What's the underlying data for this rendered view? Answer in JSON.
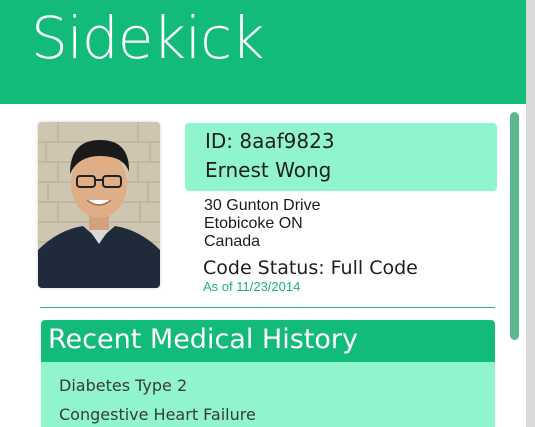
{
  "app": {
    "title": "Sidekick"
  },
  "patient": {
    "id_line": "ID: 8aaf9823",
    "name": "Ernest Wong",
    "address_line1": "30 Gunton Drive",
    "address_line2": "Etobicoke ON",
    "address_line3": "Canada",
    "code_status": "Code Status: Full Code",
    "as_of": "As of 11/23/2014"
  },
  "history": {
    "title": "Recent Medical History",
    "items": [
      "Diabetes Type 2",
      "Congestive Heart Failure"
    ]
  },
  "colors": {
    "header_green": "#13bb7b",
    "panel_mint": "#90f5cd",
    "accent_teal": "#1fb07d"
  }
}
